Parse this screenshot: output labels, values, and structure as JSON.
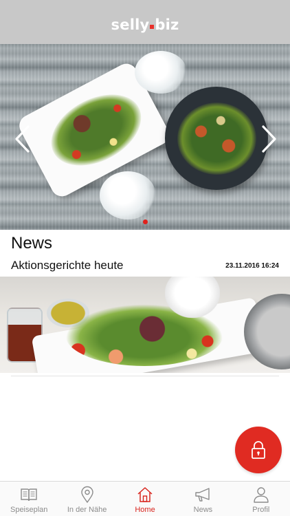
{
  "header": {
    "brand_left": "selly",
    "brand_right": "biz"
  },
  "carousel": {
    "prev_icon": "chevron-left-icon",
    "next_icon": "chevron-right-icon",
    "active_index": 0,
    "slide_count": 1
  },
  "news": {
    "section_title": "News",
    "items": [
      {
        "title": "Aktionsgerichte heute",
        "date": "23.11.2016 16:24"
      }
    ]
  },
  "fab": {
    "icon": "lock-icon",
    "color": "#e02b22"
  },
  "bottom_nav": {
    "active": "Home",
    "accent": "#d8241d",
    "items": [
      {
        "label": "Speiseplan",
        "icon": "menu-book-icon"
      },
      {
        "label": "In der Nähe",
        "icon": "location-pin-icon"
      },
      {
        "label": "Home",
        "icon": "home-icon"
      },
      {
        "label": "News",
        "icon": "megaphone-icon"
      },
      {
        "label": "Profil",
        "icon": "user-icon"
      }
    ]
  }
}
